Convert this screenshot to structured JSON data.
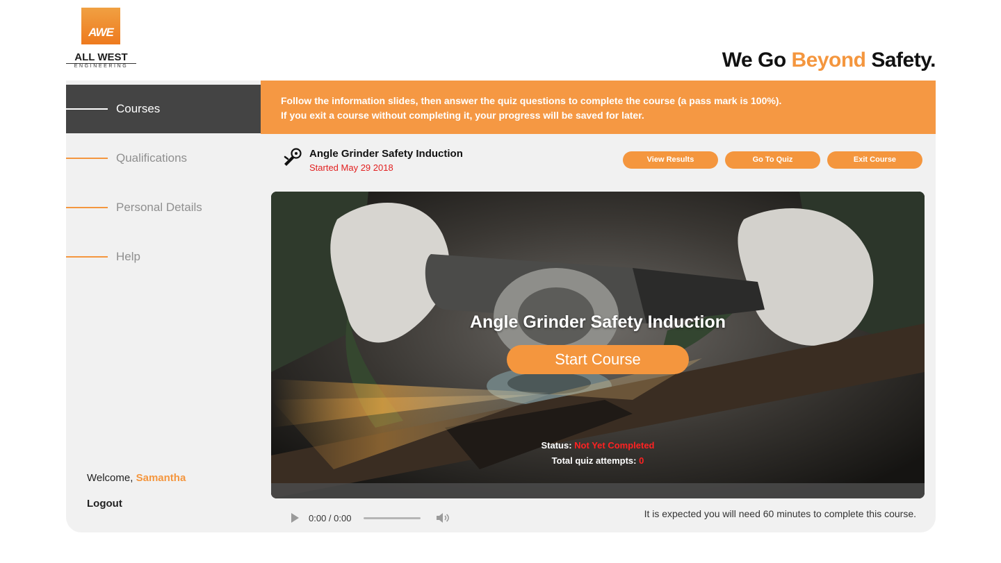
{
  "header": {
    "logo_mark": "AWE",
    "logo_name": "ALL WEST",
    "logo_sub": "ENGINEERING",
    "tagline_prefix": "We Go ",
    "tagline_accent": "Beyond",
    "tagline_suffix": " Safety."
  },
  "sidebar": {
    "items": [
      {
        "label": "Courses",
        "active": true
      },
      {
        "label": "Qualifications",
        "active": false
      },
      {
        "label": "Personal Details",
        "active": false
      },
      {
        "label": "Help",
        "active": false
      }
    ],
    "welcome_label": "Welcome,",
    "user_name": "Samantha",
    "logout_label": "Logout"
  },
  "banner": {
    "line1": "Follow the information slides, then answer the quiz questions to complete the course (a pass mark is 100%).",
    "line2": "If you exit a course without completing it, your progress will be saved for later."
  },
  "course": {
    "title": "Angle Grinder Safety Induction",
    "started": "Started May 29 2018",
    "icon": "angle-grinder-icon"
  },
  "buttons": {
    "view_results": "View Results",
    "go_to_quiz": "Go To Quiz",
    "exit_course": "Exit Course"
  },
  "hero": {
    "title": "Angle Grinder Safety Induction",
    "start_label": "Start Course",
    "status_label": "Status:",
    "status_value": "Not Yet Completed",
    "attempts_label": "Total quiz attempts:",
    "attempts_value": "0"
  },
  "audio": {
    "time": "0:00 / 0:00"
  },
  "footer_note": "It is expected you will need 60 minutes to complete this course.",
  "colors": {
    "accent": "#f4963e",
    "active_nav": "#444444",
    "panel": "#f1f1f1",
    "alert": "#e21f1f"
  }
}
